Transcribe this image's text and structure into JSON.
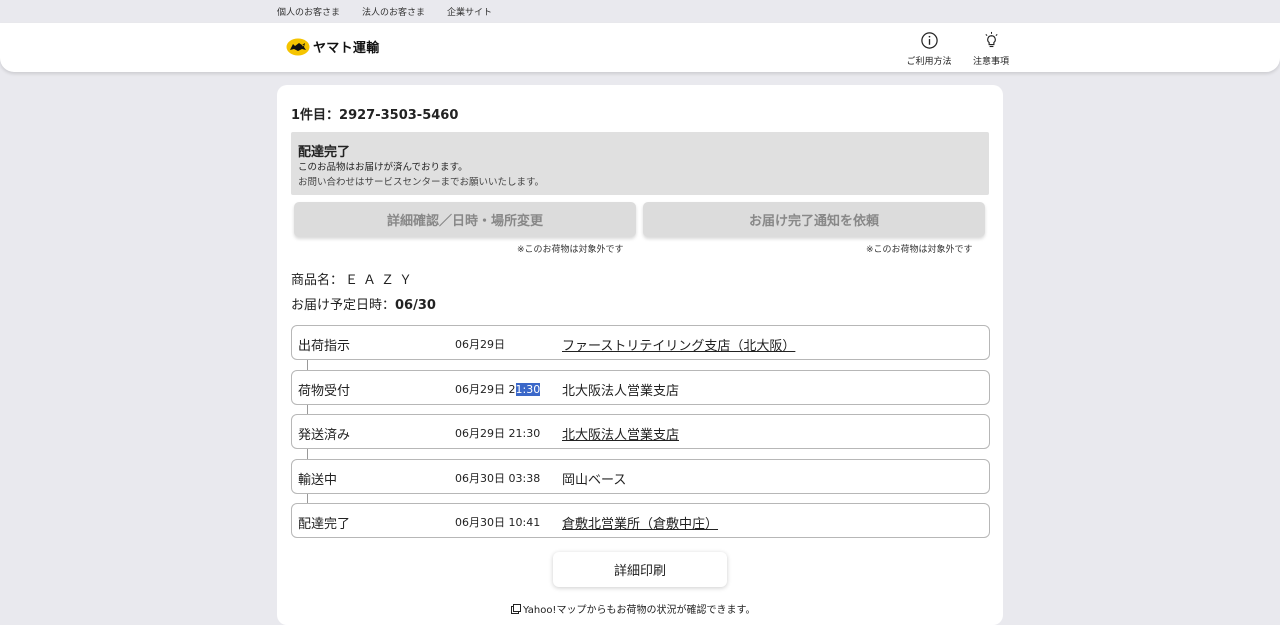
{
  "topbar": {
    "links": [
      "個人のお客さま",
      "法人のお客さま",
      "企業サイト"
    ]
  },
  "header": {
    "logo_text": "ヤマト運輸",
    "icons": [
      {
        "label": "ご利用方法",
        "icon": "info-icon"
      },
      {
        "label": "注意事項",
        "icon": "lightbulb-icon"
      }
    ]
  },
  "package": {
    "number_label": "1件目：2927-3503-5460",
    "status_title": "配達完了",
    "status_message_1": "このお品物はお届けが済んでおります。",
    "status_message_2": "お問い合わせはサービスセンターまでお願いいたします。",
    "buttons": [
      {
        "label": "詳細確認／日時・場所変更",
        "note": "※このお荷物は対象外です"
      },
      {
        "label": "お届け完了通知を依頼",
        "note": "※このお荷物は対象外です"
      }
    ],
    "product_label": "商品名：",
    "product_value": "ＥＡＺＹ",
    "eta_label": "お届け予定日時：",
    "eta_value": "06/30"
  },
  "timeline": [
    {
      "status": "出荷指示",
      "date": "06月29日",
      "time": "",
      "location": "ファーストリテイリング支店（北大阪）",
      "link": true
    },
    {
      "status": "荷物受付",
      "date": "06月29日",
      "time_pre": "2",
      "time_hl": "1:30",
      "location": "北大阪法人営業支店",
      "link": false
    },
    {
      "status": "発送済み",
      "date": "06月29日",
      "time": "21:30",
      "location": "北大阪法人営業支店",
      "link": true
    },
    {
      "status": "輸送中",
      "date": "06月30日",
      "time": "03:38",
      "location": "岡山ベース",
      "link": false
    },
    {
      "status": "配達完了",
      "date": "06月30日",
      "time": "10:41",
      "location": "倉敷北営業所（倉敷中庄）",
      "link": true
    }
  ],
  "footer": {
    "print_label": "詳細印刷",
    "yahoo_text": "Yahoo!マップからもお荷物の状況が確認できます。"
  }
}
